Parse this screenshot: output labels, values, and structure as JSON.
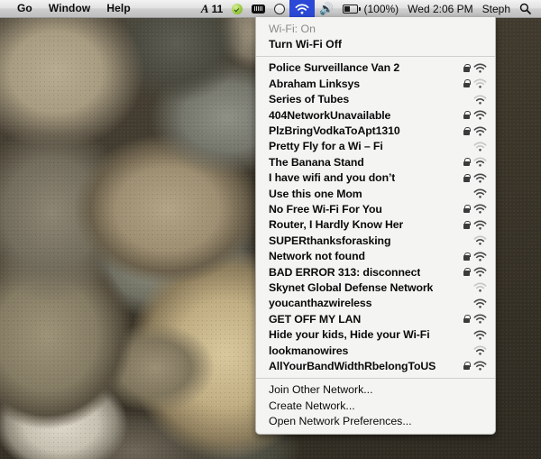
{
  "menubar": {
    "app_menus": [
      "Go",
      "Window",
      "Help"
    ],
    "status_items": [
      {
        "name": "text-indicator",
        "label": "11",
        "icon": "script-A-icon"
      },
      {
        "name": "green-check",
        "label": "",
        "icon": "check-badge-icon"
      },
      {
        "name": "eject-media",
        "label": "",
        "icon": "eject-icon"
      },
      {
        "name": "time-machine",
        "label": "",
        "icon": "time-machine-icon"
      }
    ],
    "wifi_icon": "wifi-icon",
    "volume_icon": "volume-icon",
    "battery_icon": "battery-icon",
    "battery_label": "(100%)",
    "clock": "Wed 2:06 PM",
    "user": "Steph",
    "search_icon": "search-icon",
    "accent_color": "#2b49d6"
  },
  "wifi_menu": {
    "status_label": "Wi-Fi: On",
    "toggle_label": "Turn Wi-Fi Off",
    "networks": [
      {
        "ssid": "Police Surveillance Van 2",
        "locked": true,
        "strength": 3
      },
      {
        "ssid": "Abraham Linksys",
        "locked": true,
        "strength": 1
      },
      {
        "ssid": "Series of Tubes",
        "locked": false,
        "strength": 2
      },
      {
        "ssid": "404NetworkUnavailable",
        "locked": true,
        "strength": 3
      },
      {
        "ssid": "PlzBringVodkaToApt1310",
        "locked": true,
        "strength": 3
      },
      {
        "ssid": "Pretty Fly for a Wi – Fi",
        "locked": false,
        "strength": 1
      },
      {
        "ssid": "The Banana Stand",
        "locked": true,
        "strength": 2
      },
      {
        "ssid": "I have wifi and you don’t",
        "locked": true,
        "strength": 3
      },
      {
        "ssid": "Use this one Mom",
        "locked": false,
        "strength": 3
      },
      {
        "ssid": "No Free Wi-Fi For You",
        "locked": true,
        "strength": 3
      },
      {
        "ssid": "Router, I Hardly Know Her",
        "locked": true,
        "strength": 3
      },
      {
        "ssid": "SUPERthanksforasking",
        "locked": false,
        "strength": 2
      },
      {
        "ssid": "Network not found",
        "locked": true,
        "strength": 3
      },
      {
        "ssid": "BAD ERROR 313: disconnect",
        "locked": true,
        "strength": 3
      },
      {
        "ssid": "Skynet Global Defense Network",
        "locked": false,
        "strength": 1
      },
      {
        "ssid": "youcanthazwireless",
        "locked": false,
        "strength": 3
      },
      {
        "ssid": "GET OFF MY LAN",
        "locked": true,
        "strength": 3
      },
      {
        "ssid": "Hide your kids, Hide your Wi-Fi",
        "locked": false,
        "strength": 3
      },
      {
        "ssid": "lookmanowires",
        "locked": false,
        "strength": 2
      },
      {
        "ssid": "AllYourBandWidthRbelongToUS",
        "locked": true,
        "strength": 3
      }
    ],
    "actions": [
      "Join Other Network...",
      "Create Network...",
      "Open Network Preferences..."
    ]
  },
  "desktop": {
    "wallpaper_name": "river-stones-wallpaper"
  }
}
